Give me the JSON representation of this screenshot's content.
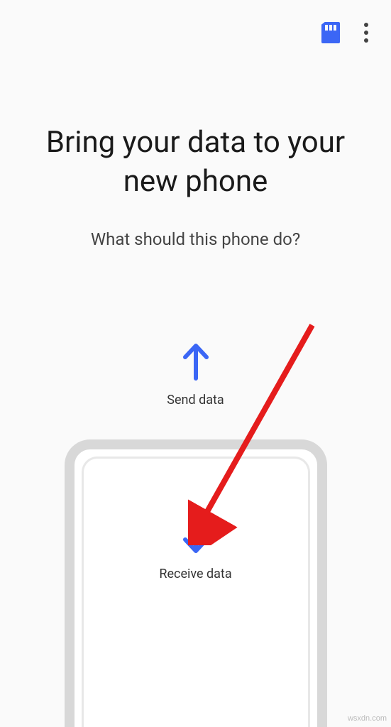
{
  "header": {
    "sd_icon": "sd-card",
    "more_icon": "more-vertical"
  },
  "title": "Bring your data to your new phone",
  "subtitle": "What should this phone do?",
  "options": {
    "send": {
      "label": "Send data",
      "icon": "arrow-up"
    },
    "receive": {
      "label": "Receive data",
      "icon": "arrow-down"
    }
  },
  "colors": {
    "accent": "#3b66f5",
    "annotation": "#e51c1c"
  },
  "watermark": "wsxdn.com"
}
